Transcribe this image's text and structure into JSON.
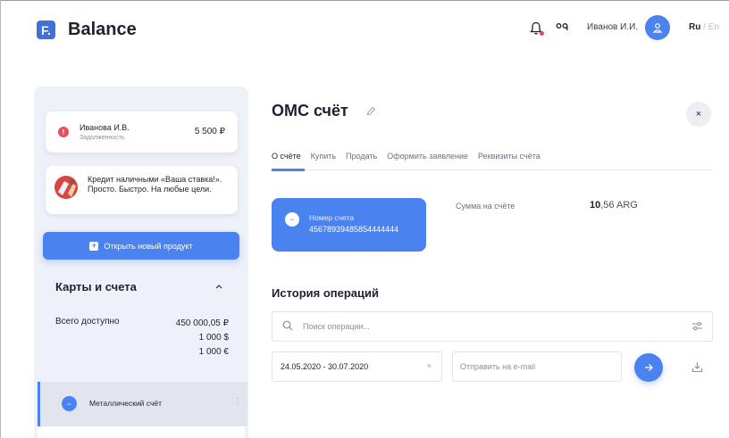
{
  "app": {
    "logo_letter": "F.",
    "name": "Balance"
  },
  "header": {
    "user_name": "Иванов И.И.",
    "lang_active": "Ru",
    "lang_sep": " / ",
    "lang_other": "En",
    "icons": [
      "bell-icon",
      "glasses-icon",
      "user-icon"
    ]
  },
  "sidebar": {
    "debt": {
      "badge": "!",
      "name": "Иванова И.В.",
      "status": "Задолженность",
      "amount": "5 500 ₽"
    },
    "promo": {
      "text": "Кредит наличными «Ваша ставка!». Просто. Быстро. На любые цели."
    },
    "open_product": {
      "icon": "+",
      "label": "Открыть новый продукт"
    },
    "accounts": {
      "title": "Карты и счета",
      "total_label": "Всего доступно",
      "total_values": [
        "450 000,05 ₽",
        "1 000 $",
        "1 000 €"
      ],
      "items": [
        {
          "label": "Металлический счёт",
          "icon": "−",
          "more": "⋮"
        }
      ]
    }
  },
  "main": {
    "title": "ОМС счёт",
    "close": "×",
    "tabs": [
      {
        "label": "О счёте",
        "active": true
      },
      {
        "label": "Купить"
      },
      {
        "label": "Продать"
      },
      {
        "label": "Оформить заявление"
      },
      {
        "label": "Реквизиты счёта"
      }
    ],
    "account_card": {
      "icon": "−",
      "label": "Номер счета",
      "number": "45678939485854444444"
    },
    "balance": {
      "label": "Сумма на счёте",
      "integer": "10",
      "fraction": ",56",
      "currency": "ARG"
    },
    "history": {
      "title": "История операций",
      "search_placeholder": "Поиск операции...",
      "date_range": "24.05.2020 - 30.07.2020",
      "date_clear": "×",
      "email_placeholder": "Отправить на e-mail"
    }
  },
  "colors": {
    "accent": "#4a82f0",
    "danger": "#e5505c",
    "sidebar_bg": "#eef1f8",
    "text": "#1e2130"
  }
}
